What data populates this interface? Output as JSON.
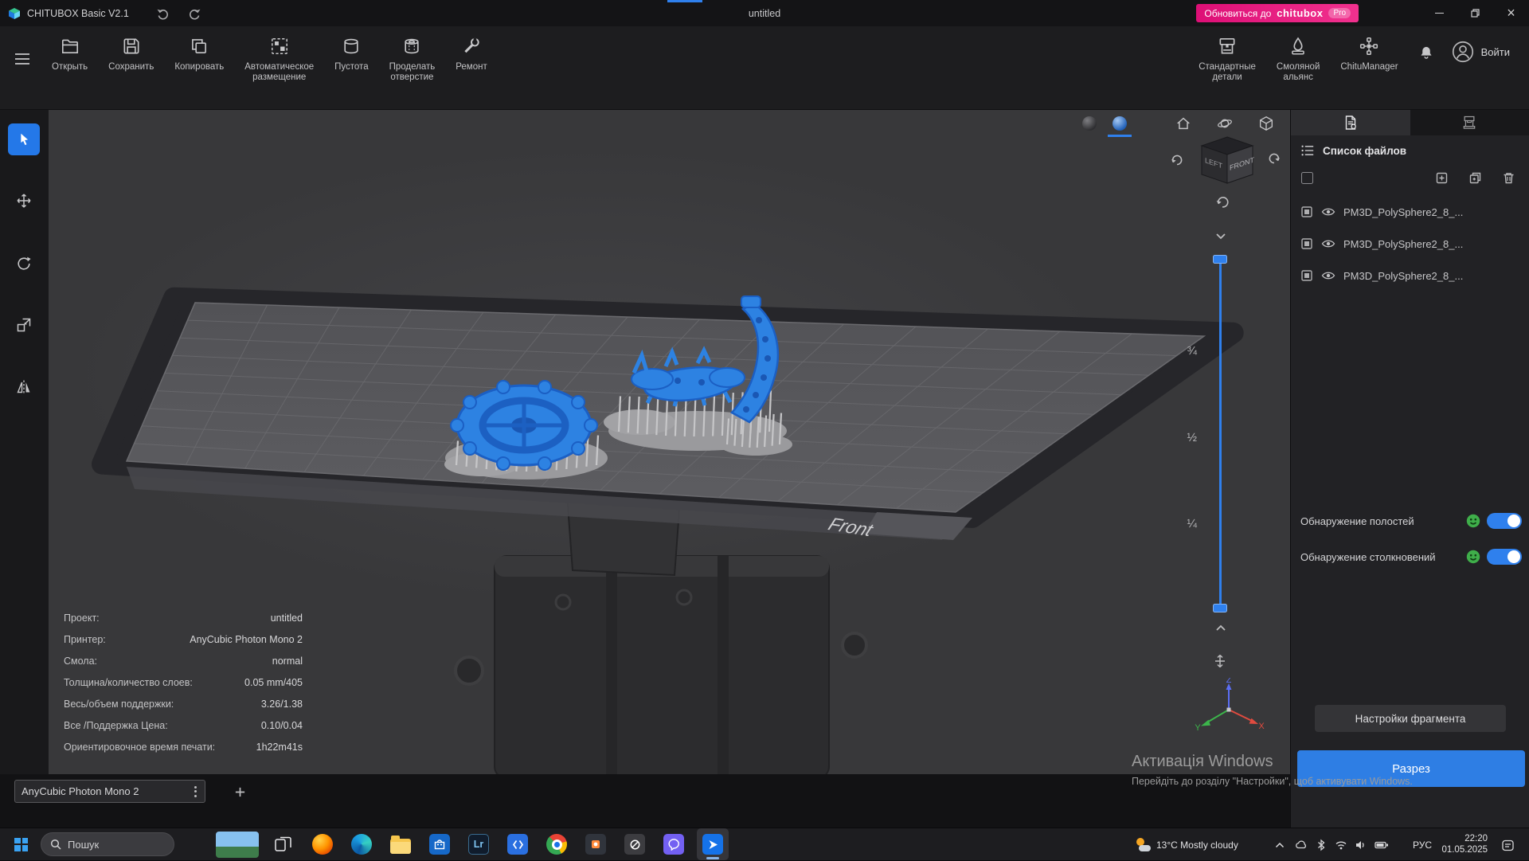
{
  "colors": {
    "accent_blue": "#2f80ed",
    "brand_pink": "#e3117e",
    "toggle_green": "#3fae4a"
  },
  "titlebar": {
    "app_title": "CHITUBOX Basic V2.1",
    "document_title": "untitled",
    "upgrade_prefix": "Обновиться до",
    "upgrade_brand": "chitubox",
    "upgrade_badge": "Pro"
  },
  "toolbar": {
    "open": {
      "l1": "Открыть"
    },
    "save": {
      "l1": "Сохранить"
    },
    "copy": {
      "l1": "Копировать"
    },
    "auto": {
      "l1": "Автоматическое",
      "l2": "размещение"
    },
    "hollow": {
      "l1": "Пустота"
    },
    "dig": {
      "l1": "Проделать",
      "l2": "отверстие"
    },
    "repair": {
      "l1": "Ремонт"
    },
    "standard_parts": {
      "l1": "Стандартные",
      "l2": "детали"
    },
    "resin": {
      "l1": "Смоляной",
      "l2": "альянс"
    },
    "chitumanager": {
      "l1": "ChituManager"
    },
    "login": "Войти"
  },
  "viewport": {
    "cube": {
      "left": "LEFT",
      "front": "FRONT"
    },
    "plate_label": "Front",
    "slider": {
      "labels": [
        "¾",
        "½",
        "¼"
      ]
    },
    "axis": {
      "x": "X",
      "y": "Y",
      "z": "Z"
    },
    "stats": [
      {
        "label": "Проект:",
        "value": "untitled"
      },
      {
        "label": "Принтер:",
        "value": "AnyCubic Photon Mono 2"
      },
      {
        "label": "Смола:",
        "value": "normal"
      },
      {
        "label": "Толщина/количество слоев:",
        "value": "0.05 mm/405"
      },
      {
        "label": "Весь/объем поддержки:",
        "value": "3.26/1.38"
      },
      {
        "label": "Все /Поддержка Цена:",
        "value": "0.10/0.04"
      },
      {
        "label": "Ориентировочное время печати:",
        "value": "1h22m41s"
      }
    ]
  },
  "printer_bar": {
    "printer": "AnyCubic Photon Mono 2"
  },
  "panel": {
    "files_title": "Список файлов",
    "files": [
      {
        "name": "PM3D_PolySphere2_8_..."
      },
      {
        "name": "PM3D_PolySphere2_8_..."
      },
      {
        "name": "PM3D_PolySphere2_8_..."
      }
    ],
    "cavity_label": "Обнаружение полостей",
    "collision_label": "Обнаружение столкновений",
    "fragment_button": "Настройки фрагмента",
    "slice_button": "Разрез"
  },
  "watermark": {
    "line1": "Активація Windows",
    "line2": "Перейдіть до розділу \"Настройки\", щоб активувати Windows."
  },
  "taskbar": {
    "search": "Пошук",
    "lr_label": "Lr",
    "app_icons": [
      "start",
      "search",
      "widgets",
      "task-view",
      "firefox",
      "edge",
      "explorer",
      "store",
      "lightroom",
      "code-app",
      "chrome",
      "editor-app",
      "utility-app",
      "viber",
      "chitubox"
    ],
    "tray": {
      "weather": "13°C Mostly cloudy",
      "lang": "РУС",
      "time": "22:20",
      "date": "01.05.2025"
    }
  }
}
